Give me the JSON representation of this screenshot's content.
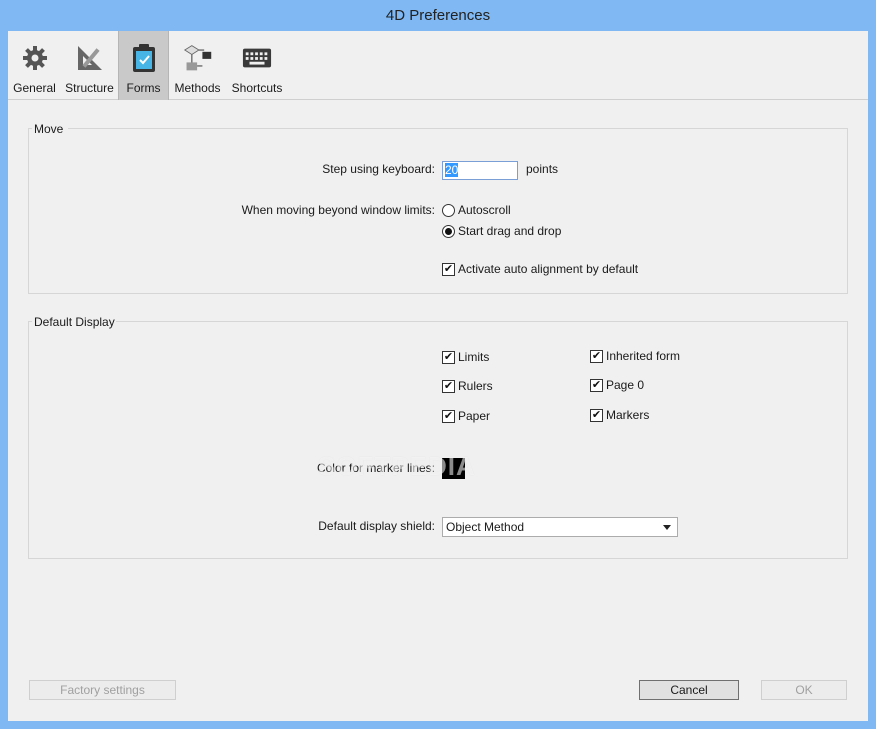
{
  "window": {
    "title": "4D Preferences"
  },
  "toolbar": {
    "items": [
      {
        "label": "General",
        "icon": "gear-icon"
      },
      {
        "label": "Structure",
        "icon": "structure-ruler-icon"
      },
      {
        "label": "Forms",
        "icon": "clipboard-form-icon",
        "active": true
      },
      {
        "label": "Methods",
        "icon": "flowchart-icon"
      },
      {
        "label": "Shortcuts",
        "icon": "keyboard-icon"
      }
    ]
  },
  "move": {
    "title": "Move",
    "step_label": "Step using keyboard:",
    "step_value": "20",
    "step_unit": "points",
    "beyond_label": "When moving beyond window limits:",
    "autoscroll_label": "Autoscroll",
    "autoscroll_checked": false,
    "drag_label": "Start drag and drop",
    "drag_checked": true,
    "auto_align_label": "Activate auto alignment by default",
    "auto_align_checked": true
  },
  "default_display": {
    "title": "Default Display",
    "checks": [
      {
        "label": "Limits",
        "checked": true
      },
      {
        "label": "Inherited form",
        "checked": true
      },
      {
        "label": "Rulers",
        "checked": true
      },
      {
        "label": "Page 0",
        "checked": true
      },
      {
        "label": "Paper",
        "checked": true
      },
      {
        "label": "Markers",
        "checked": true
      }
    ],
    "marker_color_label": "Color for marker lines:",
    "marker_color": "#000000",
    "shield_label": "Default display shield:",
    "shield_value": "Object Method"
  },
  "footer": {
    "factory_label": "Factory settings",
    "cancel_label": "Cancel",
    "ok_label": "OK"
  },
  "watermark": "SOFTPEDIA",
  "colors": {
    "titlebar": "#7fb8f2",
    "selection": "#3399ff"
  }
}
